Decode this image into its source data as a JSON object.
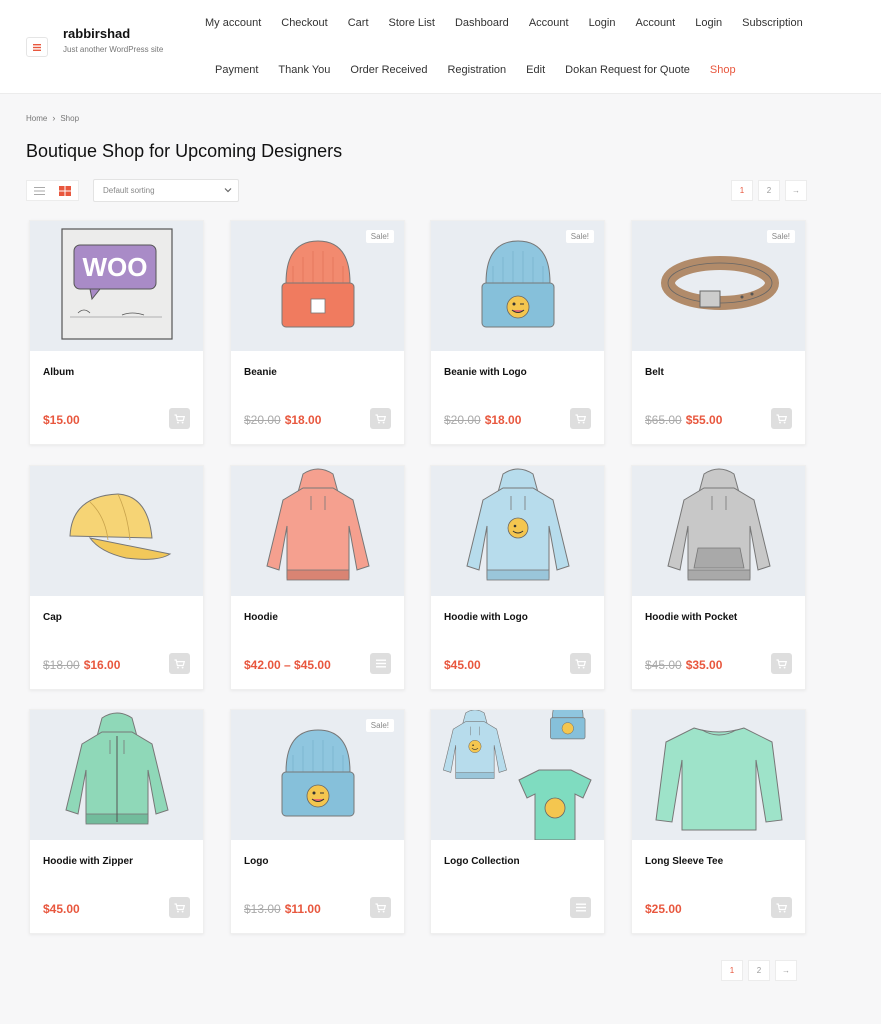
{
  "site": {
    "title": "rabbirshad",
    "tagline": "Just another WordPress site"
  },
  "nav": {
    "row1": [
      "My account",
      "Checkout",
      "Cart",
      "Store List",
      "Dashboard",
      "Account",
      "Login",
      "Account",
      "Login",
      "Subscription"
    ],
    "row2": [
      "Payment",
      "Thank You",
      "Order Received",
      "Registration",
      "Edit",
      "Dokan Request for Quote",
      "Shop"
    ],
    "active": "Shop"
  },
  "breadcrumb": {
    "home": "Home",
    "separator": "›",
    "current": "Shop"
  },
  "page_title": "Boutique Shop for Upcoming Designers",
  "sorting": {
    "selected": "Default sorting"
  },
  "pagination": {
    "pages": [
      "1",
      "2"
    ],
    "current": "1",
    "next": "→"
  },
  "sale_label": "Sale!",
  "colors": {
    "accent": "#e8573e",
    "card_image_bg": "#e9edf2",
    "cart_button": "#dedede"
  },
  "products": [
    {
      "name": "Album",
      "price": "$15.00",
      "old_price": "",
      "sale": false,
      "button_icon": "cart-icon",
      "image": "album"
    },
    {
      "name": "Beanie",
      "price": "$18.00",
      "old_price": "$20.00",
      "sale": true,
      "button_icon": "cart-icon",
      "image": "beanie-orange"
    },
    {
      "name": "Beanie with Logo",
      "price": "$18.00",
      "old_price": "$20.00",
      "sale": true,
      "button_icon": "cart-icon",
      "image": "beanie-blue"
    },
    {
      "name": "Belt",
      "price": "$55.00",
      "old_price": "$65.00",
      "sale": true,
      "button_icon": "cart-icon",
      "image": "belt"
    },
    {
      "name": "Cap",
      "price": "$16.00",
      "old_price": "$18.00",
      "sale": false,
      "button_icon": "cart-icon",
      "image": "cap"
    },
    {
      "name": "Hoodie",
      "price": "$42.00 – $45.00",
      "old_price": "",
      "sale": false,
      "button_icon": "list-icon",
      "image": "hoodie-pink"
    },
    {
      "name": "Hoodie with Logo",
      "price": "$45.00",
      "old_price": "",
      "sale": false,
      "button_icon": "cart-icon",
      "image": "hoodie-blue"
    },
    {
      "name": "Hoodie with Pocket",
      "price": "$35.00",
      "old_price": "$45.00",
      "sale": false,
      "button_icon": "cart-icon",
      "image": "hoodie-gray"
    },
    {
      "name": "Hoodie with Zipper",
      "price": "$45.00",
      "old_price": "",
      "sale": false,
      "button_icon": "cart-icon",
      "image": "hoodie-green"
    },
    {
      "name": "Logo",
      "price": "$11.00",
      "old_price": "$13.00",
      "sale": true,
      "button_icon": "cart-icon",
      "image": "beanie-blue"
    },
    {
      "name": "Logo Collection",
      "price": "",
      "old_price": "",
      "sale": false,
      "button_icon": "list-icon",
      "image": "collection"
    },
    {
      "name": "Long Sleeve Tee",
      "price": "$25.00",
      "old_price": "",
      "sale": false,
      "button_icon": "cart-icon",
      "image": "tee-green"
    }
  ]
}
